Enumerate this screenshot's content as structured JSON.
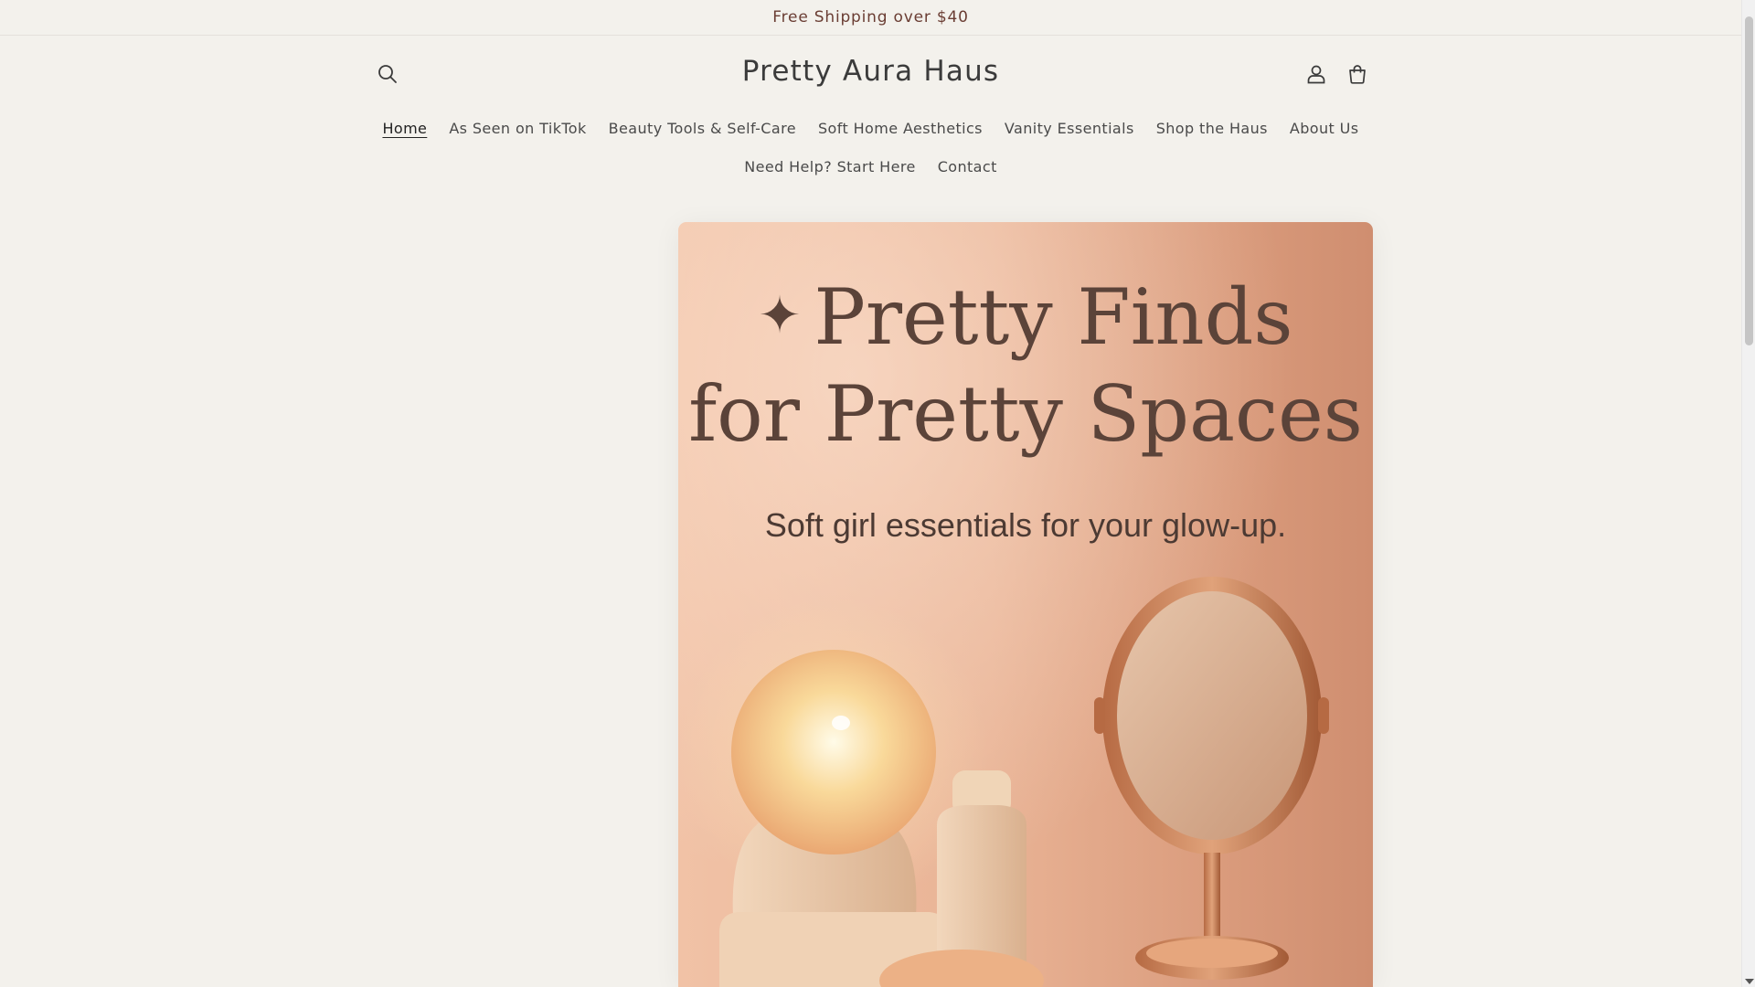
{
  "announcement": {
    "text": "Free Shipping over $40"
  },
  "header": {
    "brand": "Pretty Aura Haus",
    "icons": {
      "search": "search-icon",
      "account": "account-icon",
      "cart": "cart-icon"
    }
  },
  "nav": {
    "row1": [
      {
        "label": "Home",
        "active": true
      },
      {
        "label": "As Seen on TikTok"
      },
      {
        "label": "Beauty Tools & Self-Care"
      },
      {
        "label": "Soft Home Aesthetics"
      },
      {
        "label": "Vanity Essentials"
      },
      {
        "label": "Shop the Haus"
      },
      {
        "label": "About Us"
      }
    ],
    "row2": [
      {
        "label": "Need Help? Start Here"
      },
      {
        "label": "Contact"
      }
    ]
  },
  "hero": {
    "sparkle": "✦",
    "title_line1": "Pretty Finds",
    "title_line2": "for Pretty Spaces",
    "subtitle": "Soft girl essentials for your glow-up."
  },
  "colors": {
    "page_bg": "#f3f1ec",
    "announcement_text": "#6a3d33",
    "hero_peach": "#e9b395",
    "hero_text": "#5b4339"
  }
}
